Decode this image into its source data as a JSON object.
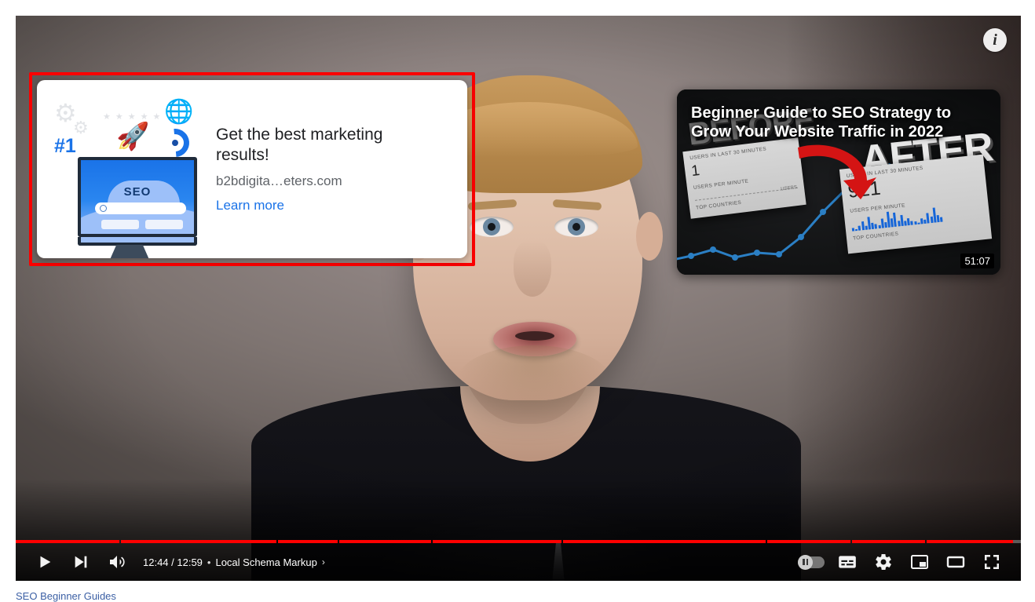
{
  "player": {
    "info_badge_label": "i",
    "duration_total": "12:59",
    "time_current": "12:44",
    "time_display": "12:44 / 12:59",
    "time_separator": "•",
    "chapter_name": "Local Schema Markup",
    "chapter_chevron": "›",
    "progress_percent": 98.1,
    "accent_color": "#ff0000",
    "controls": {
      "play_label": "play-pause",
      "next_label": "next-video",
      "volume_label": "volume-mute",
      "autoplay_label": "autoplay-toggle",
      "subtitles_label": "subtitles-closed-captions",
      "settings_label": "settings",
      "miniplayer_label": "miniplayer",
      "theater_label": "theater-mode",
      "fullscreen_label": "fullscreen"
    },
    "chapters": [
      {
        "name": "chapter-1",
        "width_percent": 10.3,
        "filled_percent": 100
      },
      {
        "name": "chapter-2",
        "width_percent": 15.5,
        "filled_percent": 100
      },
      {
        "name": "chapter-3",
        "width_percent": 5.9,
        "filled_percent": 100
      },
      {
        "name": "chapter-4",
        "width_percent": 9.2,
        "filled_percent": 100
      },
      {
        "name": "chapter-5",
        "width_percent": 12.8,
        "filled_percent": 100
      },
      {
        "name": "chapter-6",
        "width_percent": 20.1,
        "filled_percent": 100
      },
      {
        "name": "chapter-7",
        "width_percent": 8.3,
        "filled_percent": 100
      },
      {
        "name": "chapter-8",
        "width_percent": 7.3,
        "filled_percent": 100
      },
      {
        "name": "chapter-9",
        "width_percent": 10.6,
        "filled_percent": 81
      }
    ]
  },
  "ad_overlay": {
    "highlight_color": "#fb0000",
    "title": "Get the best marketing results!",
    "display_url": "b2bdigita…eters.com",
    "cta": "Learn more",
    "illustration": {
      "rank_badge": "#1",
      "screen_label": "SEO",
      "gear_icon": "⚙",
      "globe_icon": "🌐",
      "rocket_icon": "🚀",
      "stars": "★★★★★"
    }
  },
  "suggested_video": {
    "title": "Beginner Guide to SEO Strategy to Grow Your Website Traffic in 2022",
    "duration": "51:07",
    "word_before": "BEFORE",
    "word_after": "AFTER",
    "panel_before": {
      "label_users_30": "USERS IN LAST 30 MINUTES",
      "value": "1",
      "label_users_per_minute": "USERS PER MINUTE",
      "label_users": "USERS",
      "label_top_countries": "TOP COUNTRIES"
    },
    "panel_after": {
      "label_users_30": "USERS IN LAST 30 MINUTES",
      "value": "921",
      "label_users_per_minute": "USERS PER MINUTE",
      "label_top_countries": "TOP COUNTRIES",
      "sparkline": [
        3,
        2,
        5,
        9,
        4,
        14,
        7,
        5,
        3,
        10,
        6,
        17,
        9,
        15,
        6,
        12,
        5,
        8,
        4,
        3,
        2,
        6,
        4,
        11,
        7,
        16,
        8,
        5
      ]
    }
  },
  "below_player": {
    "caption": "SEO Beginner Guides"
  }
}
